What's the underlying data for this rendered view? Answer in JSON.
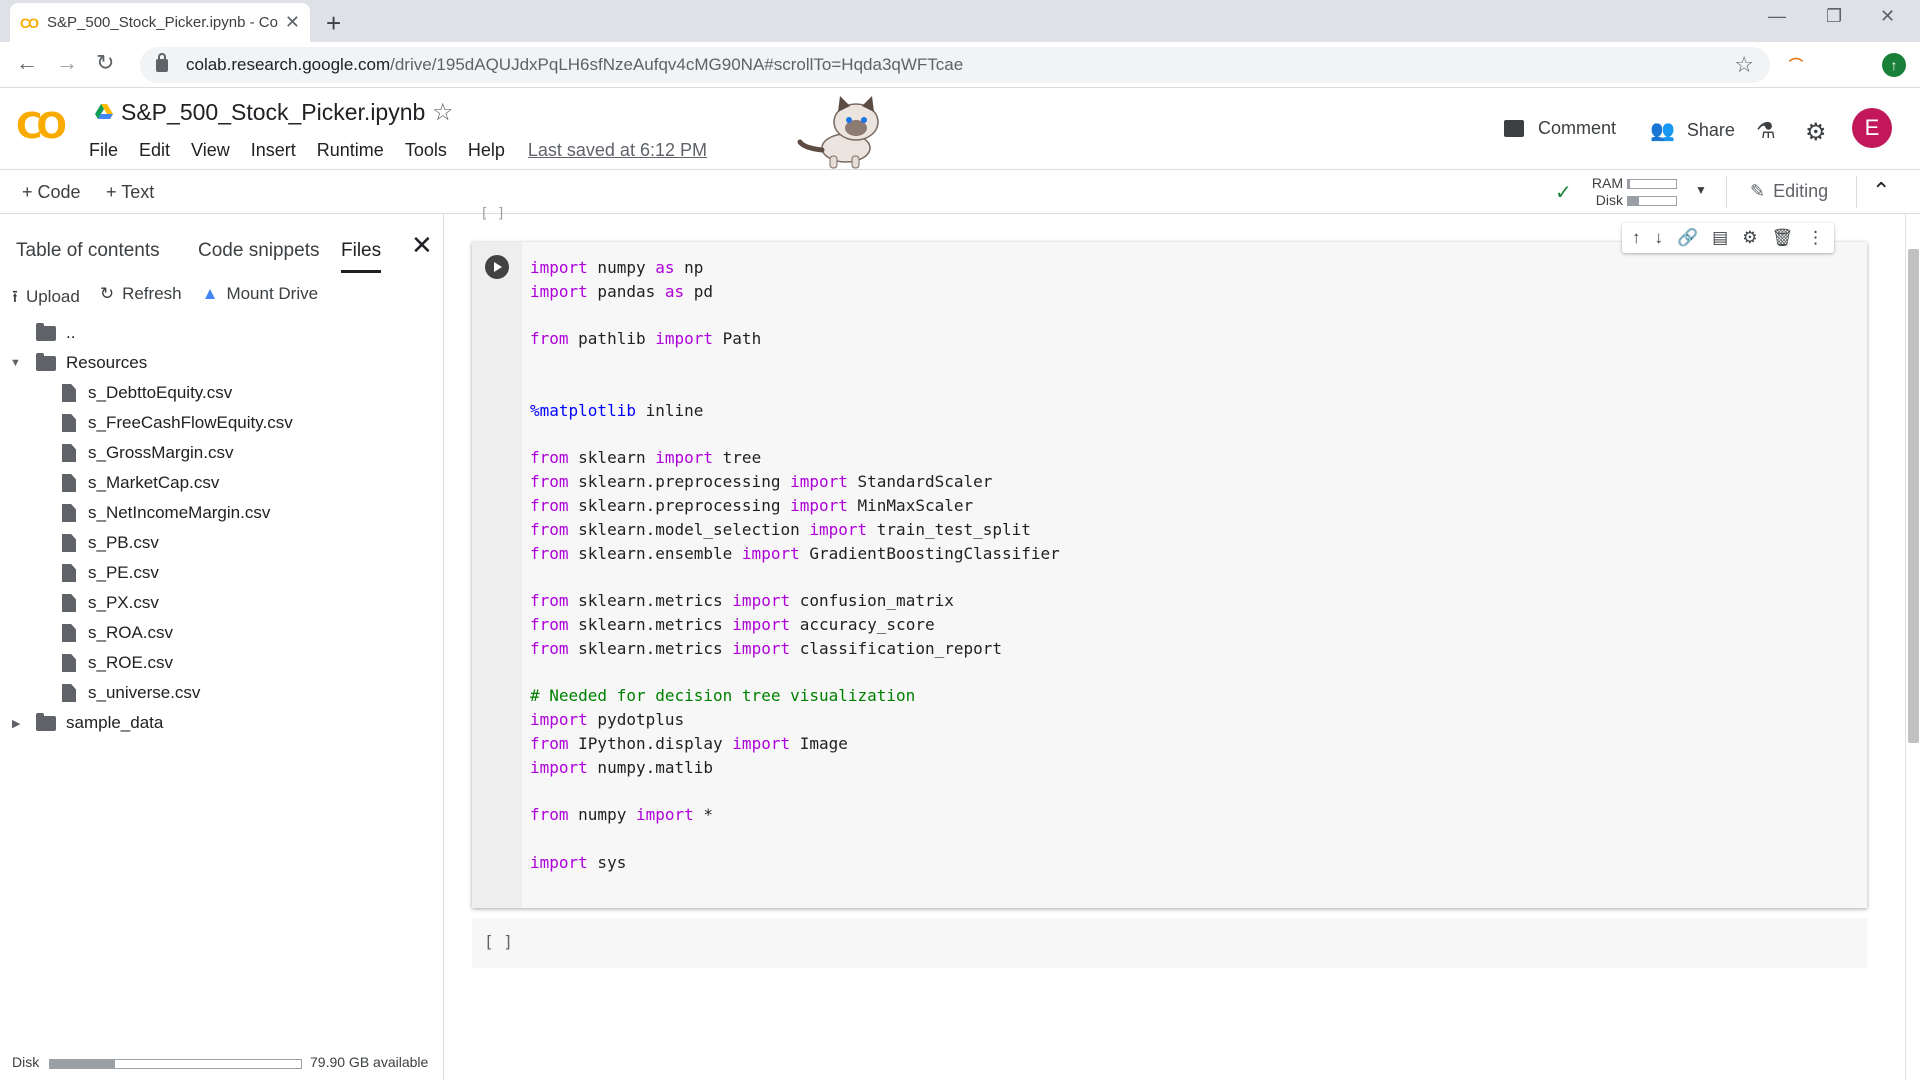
{
  "browser": {
    "tab_title": "S&P_500_Stock_Picker.ipynb - Co",
    "tab_icon": "CO",
    "close_glyph": "✕",
    "newtab_glyph": "+",
    "url_host": "colab.research.google.com",
    "url_rest": "/drive/195dAQUJdxPqLH6sfNzeAufqv4cMG90NA#scrollTo=Hqda3qWFTcae",
    "profile_initial": "E",
    "profile_color": "#c2185b"
  },
  "header": {
    "logo": "CO",
    "title": "S&P_500_Stock_Picker.ipynb",
    "menu": [
      "File",
      "Edit",
      "View",
      "Insert",
      "Runtime",
      "Tools",
      "Help"
    ],
    "last_saved": "Last saved at 6:12 PM",
    "comment_label": "Comment",
    "share_label": "Share",
    "avatar_initial": "E",
    "avatar_color": "#c2185b"
  },
  "toolbar": {
    "add_code": "+ Code",
    "add_text": "+ Text",
    "ram_label": "RAM",
    "disk_label": "Disk",
    "ram_usage": 0.04,
    "disk_usage": 0.22,
    "editing_label": "Editing"
  },
  "sidepanel": {
    "tabs": [
      "Table of contents",
      "Code snippets",
      "Files"
    ],
    "active_tab": "Files",
    "actions": {
      "upload": "Upload",
      "refresh": "Refresh",
      "mount": "Mount Drive"
    },
    "parent": "..",
    "resources_folder": "Resources",
    "files": [
      "s_DebttoEquity.csv",
      "s_FreeCashFlowEquity.csv",
      "s_GrossMargin.csv",
      "s_MarketCap.csv",
      "s_NetIncomeMargin.csv",
      "s_PB.csv",
      "s_PE.csv",
      "s_PX.csv",
      "s_ROA.csv",
      "s_ROE.csv",
      "s_universe.csv"
    ],
    "sample_folder": "sample_data",
    "disk_label": "Disk",
    "disk_usage": 0.26,
    "disk_available": "79.90 GB available"
  },
  "notebook": {
    "empty_cell": "[ ]",
    "code_lines": [
      [
        [
          "kw",
          "import"
        ],
        [
          "t",
          " numpy "
        ],
        [
          "kw",
          "as"
        ],
        [
          "t",
          " np"
        ]
      ],
      [
        [
          "kw",
          "import"
        ],
        [
          "t",
          " pandas "
        ],
        [
          "kw",
          "as"
        ],
        [
          "t",
          " pd"
        ]
      ],
      [],
      [
        [
          "kw",
          "from"
        ],
        [
          "t",
          " pathlib "
        ],
        [
          "kw",
          "import"
        ],
        [
          "t",
          " Path"
        ]
      ],
      [],
      [],
      [
        [
          "mg",
          "%matplotlib"
        ],
        [
          "t",
          " inline"
        ]
      ],
      [],
      [
        [
          "kw",
          "from"
        ],
        [
          "t",
          " sklearn "
        ],
        [
          "kw",
          "import"
        ],
        [
          "t",
          " tree"
        ]
      ],
      [
        [
          "kw",
          "from"
        ],
        [
          "t",
          " sklearn.preprocessing "
        ],
        [
          "kw",
          "import"
        ],
        [
          "t",
          " StandardScaler"
        ]
      ],
      [
        [
          "kw",
          "from"
        ],
        [
          "t",
          " sklearn.preprocessing "
        ],
        [
          "kw",
          "import"
        ],
        [
          "t",
          " MinMaxScaler"
        ]
      ],
      [
        [
          "kw",
          "from"
        ],
        [
          "t",
          " sklearn.model_selection "
        ],
        [
          "kw",
          "import"
        ],
        [
          "t",
          " train_test_split"
        ]
      ],
      [
        [
          "kw",
          "from"
        ],
        [
          "t",
          " sklearn.ensemble "
        ],
        [
          "kw",
          "import"
        ],
        [
          "t",
          " GradientBoostingClassifier"
        ]
      ],
      [],
      [
        [
          "kw",
          "from"
        ],
        [
          "t",
          " sklearn.metrics "
        ],
        [
          "kw",
          "import"
        ],
        [
          "t",
          " confusion_matrix"
        ]
      ],
      [
        [
          "kw",
          "from"
        ],
        [
          "t",
          " sklearn.metrics "
        ],
        [
          "kw",
          "import"
        ],
        [
          "t",
          " accuracy_score"
        ]
      ],
      [
        [
          "kw",
          "from"
        ],
        [
          "t",
          " sklearn.metrics "
        ],
        [
          "kw",
          "import"
        ],
        [
          "t",
          " classification_report"
        ]
      ],
      [],
      [
        [
          "cm",
          "# Needed for decision tree visualization"
        ]
      ],
      [
        [
          "kw",
          "import"
        ],
        [
          "t",
          " pydotplus"
        ]
      ],
      [
        [
          "kw",
          "from"
        ],
        [
          "t",
          " IPython.display "
        ],
        [
          "kw",
          "import"
        ],
        [
          "t",
          " Image"
        ]
      ],
      [
        [
          "kw",
          "import"
        ],
        [
          "t",
          " numpy.matlib"
        ]
      ],
      [],
      [
        [
          "kw",
          "from"
        ],
        [
          "t",
          " numpy "
        ],
        [
          "kw",
          "import"
        ],
        [
          "t",
          " *"
        ]
      ],
      [],
      [
        [
          "kw",
          "import"
        ],
        [
          "t",
          " sys"
        ]
      ]
    ]
  }
}
